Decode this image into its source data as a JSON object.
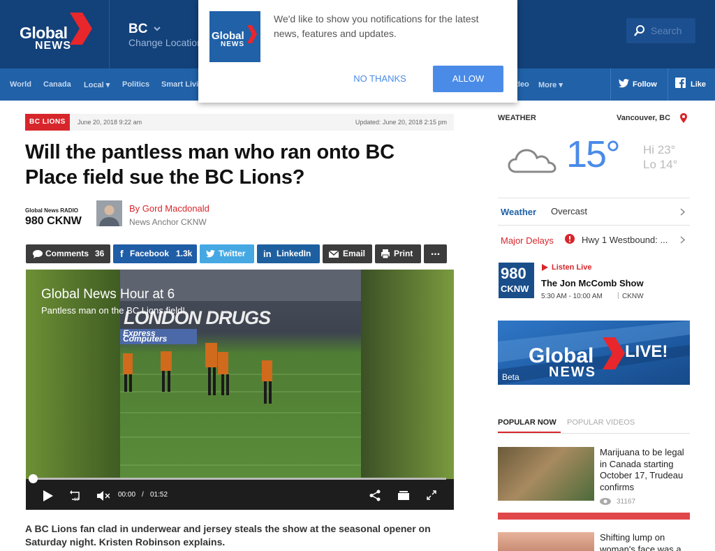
{
  "header": {
    "logo_line1": "Global",
    "logo_line2": "NEWS",
    "region": "BC",
    "change_location": "Change Location",
    "search_placeholder": "Search"
  },
  "nav": {
    "items": [
      "World",
      "Canada",
      "Local",
      "Politics",
      "Smart Living",
      "Video",
      "More"
    ],
    "follow": "Follow",
    "like": "Like"
  },
  "notification": {
    "message": "We'd like to show you notifications for the latest news, features and updates.",
    "no_thanks": "NO THANKS",
    "allow": "ALLOW",
    "logo_line1": "Global",
    "logo_line2": "NEWS"
  },
  "article": {
    "category": "BC LIONS",
    "published": "June 20, 2018 9:22 am",
    "updated": "Updated: June 20, 2018 2:15 pm",
    "title": "Will the pantless man who ran onto BC Place field sue the BC Lions?",
    "radio_brand": "Global News RADIO",
    "radio_station": "980 CKNW",
    "author": "By Gord Macdonald",
    "author_role": "News Anchor  CKNW",
    "lead": "A BC Lions fan clad in underwear and jersey steals the show at the seasonal opener on Saturday night. Kristen Robinson explains."
  },
  "share": {
    "comments": "Comments",
    "comments_count": "36",
    "facebook": "Facebook",
    "facebook_count": "1.3k",
    "twitter": "Twitter",
    "linkedin": "LinkedIn",
    "email": "Email",
    "print": "Print",
    "more": "..."
  },
  "video": {
    "title": "Global News Hour at 6",
    "subtitle": "Pantless man on the BC Lions field!",
    "signage1": "LONDON DRUGS",
    "signage2": "Express Computers",
    "current_time": "00:00",
    "separator": "/",
    "duration": "01:52",
    "progress": 0
  },
  "weather": {
    "label": "WEATHER",
    "location": "Vancouver, BC",
    "temp": "15°",
    "hi": "Hi 23°",
    "lo": "Lo 14°",
    "weather_link": "Weather",
    "condition": "Overcast",
    "delays_link": "Major Delays",
    "delays_text": "Hwy 1 Westbound: ..."
  },
  "radio": {
    "logo_top": "980",
    "logo_bottom": "CKNW",
    "listen_live": "Listen Live",
    "show": "The Jon McComb Show",
    "time": "5:30 AM - 10:00 AM",
    "station": "CKNW"
  },
  "live_banner": {
    "line1": "Global",
    "line2": "NEWS",
    "live": "LIVE!",
    "beta": "Beta"
  },
  "popular": {
    "tab1": "POPULAR NOW",
    "tab2": "POPULAR VIDEOS",
    "items": [
      {
        "title": "Marijuana to be legal in Canada starting October 17, Trudeau confirms",
        "views": "31167"
      },
      {
        "title": "Shifting lump on woman's face was a"
      }
    ]
  }
}
